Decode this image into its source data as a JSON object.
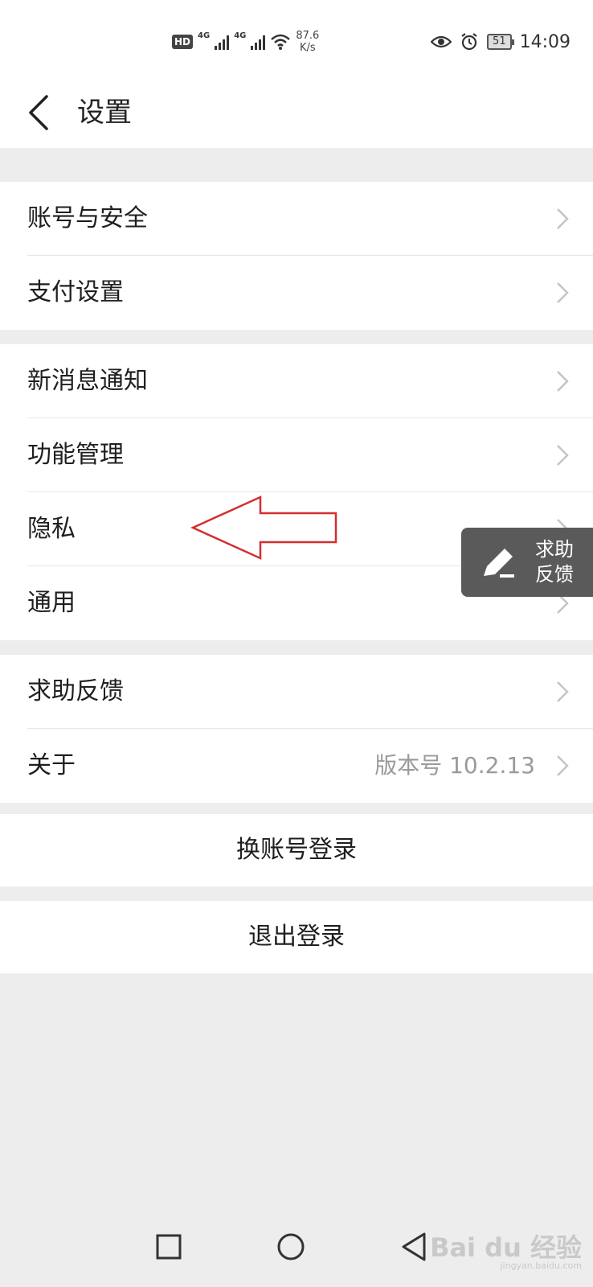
{
  "status_bar": {
    "hd": "HD",
    "net1": "4G",
    "net2": "4G",
    "speed_value": "87.6",
    "speed_unit": "K/s",
    "battery": "51",
    "time": "14:09"
  },
  "header": {
    "title": "设置"
  },
  "groups": [
    {
      "items": [
        {
          "label": "账号与安全"
        },
        {
          "label": "支付设置"
        }
      ]
    },
    {
      "items": [
        {
          "label": "新消息通知"
        },
        {
          "label": "功能管理"
        },
        {
          "label": "隐私"
        },
        {
          "label": "通用"
        }
      ]
    },
    {
      "items": [
        {
          "label": "求助反馈"
        },
        {
          "label": "关于",
          "value": "版本号 10.2.13"
        }
      ]
    }
  ],
  "actions": {
    "switch_account": "换账号登录",
    "logout": "退出登录"
  },
  "help_float": {
    "line1": "求助",
    "line2": "反馈"
  },
  "watermark": {
    "brand": "Bai du 经验",
    "url": "jingyan.baidu.com"
  },
  "colors": {
    "background": "#ededed",
    "annotation_arrow": "#d32f2f",
    "float_button": "#5a5a5a"
  }
}
